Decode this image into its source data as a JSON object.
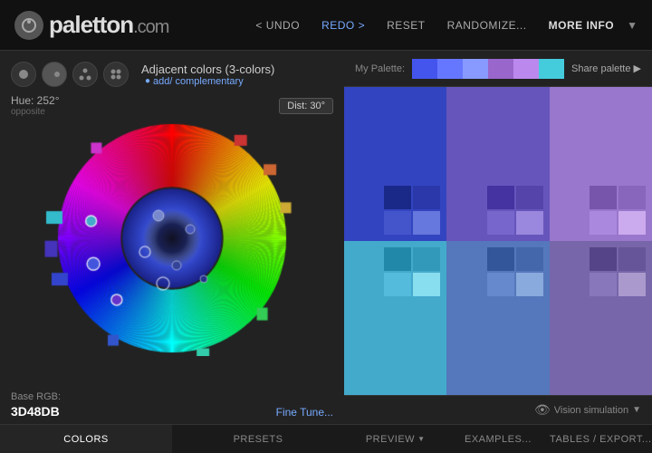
{
  "header": {
    "logo_text": "paletton",
    "logo_suffix": ".com",
    "nav": {
      "undo": "< UNDO",
      "redo": "REDO >",
      "reset": "RESET",
      "randomize": "RANDOMIZE...",
      "more_info": "MORE INFO"
    }
  },
  "left_panel": {
    "mode_label": "Adjacent colors (3-colors)",
    "add_complementary": "add/ complementary",
    "hue_label": "Hue: 252°",
    "opposite_label": "opposite",
    "dist_label": "Dist: 30°",
    "base_rgb_label": "Base RGB:",
    "base_rgb_value": "3D48DB",
    "fine_tune": "Fine Tune...",
    "tabs": [
      {
        "label": "COLORS",
        "active": true
      },
      {
        "label": "PRESETS",
        "active": false
      }
    ]
  },
  "right_panel": {
    "palette_label": "My Palette:",
    "share_label": "Share palette ▶",
    "palette_swatches": [
      "#4455ee",
      "#6677ff",
      "#8899ff",
      "#9966cc",
      "#bb88ee",
      "#44ccdd"
    ],
    "vision_sim": "Vision simulation",
    "tabs": [
      {
        "label": "PREVIEW",
        "arrow": "▼"
      },
      {
        "label": "EXAMPLES...",
        "arrow": ""
      },
      {
        "label": "TABLES / EXPORT...",
        "arrow": ""
      }
    ]
  },
  "color_grid": {
    "cells": [
      {
        "bg": "#3344bb",
        "swatches": [
          "#1a2a88",
          "#2a3ab8",
          "#4455cc",
          "#6677ee"
        ]
      },
      {
        "bg": "#6655bb",
        "swatches": [
          "#4433aa",
          "#5544bb",
          "#7766cc",
          "#9988dd"
        ]
      },
      {
        "bg": "#8877cc",
        "swatches": [
          "#6655aa",
          "#7766bb",
          "#9988cc",
          "#bbaadd"
        ]
      },
      {
        "bg": "#44aacc",
        "swatches": [
          "#2288aa",
          "#3399bb",
          "#55bbcc",
          "#77ddee"
        ]
      },
      {
        "bg": "#5588bb",
        "swatches": [
          "#336699",
          "#4477aa",
          "#6699cc",
          "#88bbdd"
        ]
      },
      {
        "bg": "#7766aa",
        "swatches": [
          "#554488",
          "#665599",
          "#8877bb",
          "#aa99cc"
        ]
      }
    ]
  }
}
